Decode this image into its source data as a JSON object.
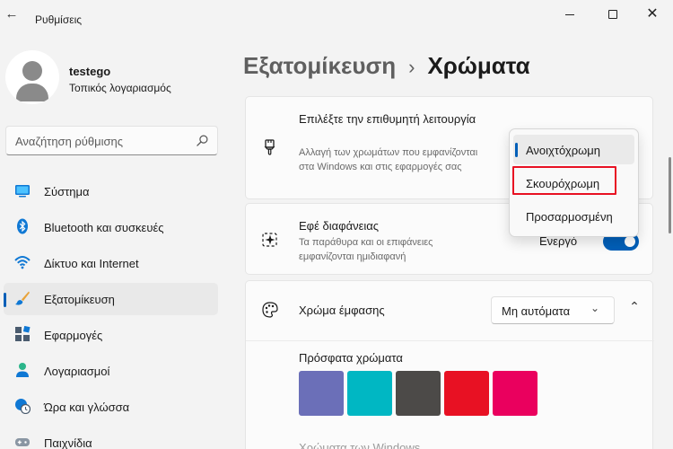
{
  "window": {
    "title": "Ρυθμίσεις",
    "back_glyph": "←",
    "close_glyph": "✕"
  },
  "profile": {
    "name": "testego",
    "account_type": "Τοπικός λογαριασμός"
  },
  "search": {
    "placeholder": "Αναζήτηση ρύθμισης"
  },
  "sidebar": {
    "items": [
      {
        "label": "Σύστημα",
        "icon": "system-icon"
      },
      {
        "label": "Bluetooth και συσκευές",
        "icon": "bluetooth-icon"
      },
      {
        "label": "Δίκτυο και Internet",
        "icon": "wifi-icon"
      },
      {
        "label": "Εξατομίκευση",
        "icon": "brush-icon",
        "active": true
      },
      {
        "label": "Εφαρμογές",
        "icon": "apps-icon"
      },
      {
        "label": "Λογαριασμοί",
        "icon": "accounts-icon"
      },
      {
        "label": "Ώρα και γλώσσα",
        "icon": "globe-clock-icon"
      },
      {
        "label": "Παιχνίδια",
        "icon": "gamepad-icon"
      }
    ]
  },
  "breadcrumb": {
    "parent": "Εξατομίκευση",
    "separator": "›",
    "current": "Χρώματα"
  },
  "mode_card": {
    "title": "Επιλέξτε την επιθυμητή λειτουργία",
    "subtitle": "Αλλαγή των χρωμάτων που εμφανίζονται στα Windows και στις εφαρμογές σας",
    "dropdown_options": [
      "Ανοιχτόχρωμη",
      "Σκουρόχρωμη",
      "Προσαρμοσμένη"
    ],
    "selected_option": "Ανοιχτόχρωμη",
    "highlighted_option": "Σκουρόχρωμη"
  },
  "transparency_card": {
    "title": "Εφέ διαφάνειας",
    "subtitle": "Τα παράθυρα και οι επιφάνειες εμφανίζονται ημιδιαφανή",
    "toggle_label": "Ενεργό",
    "toggle_on": true
  },
  "accent_card": {
    "title": "Χρώμα έμφασης",
    "select_value": "Μη αυτόματα",
    "chevron_down": "⌄",
    "chevron_up": "⌃",
    "recent_label": "Πρόσφατα χρώματα",
    "recent_colors": [
      "#6b6fb8",
      "#00b7c3",
      "#4c4a48",
      "#e81123",
      "#ea005e"
    ],
    "partial_text": "Χρώματα των Windows"
  },
  "colors": {
    "accent": "#005fb8",
    "highlight_border": "#e81123"
  }
}
